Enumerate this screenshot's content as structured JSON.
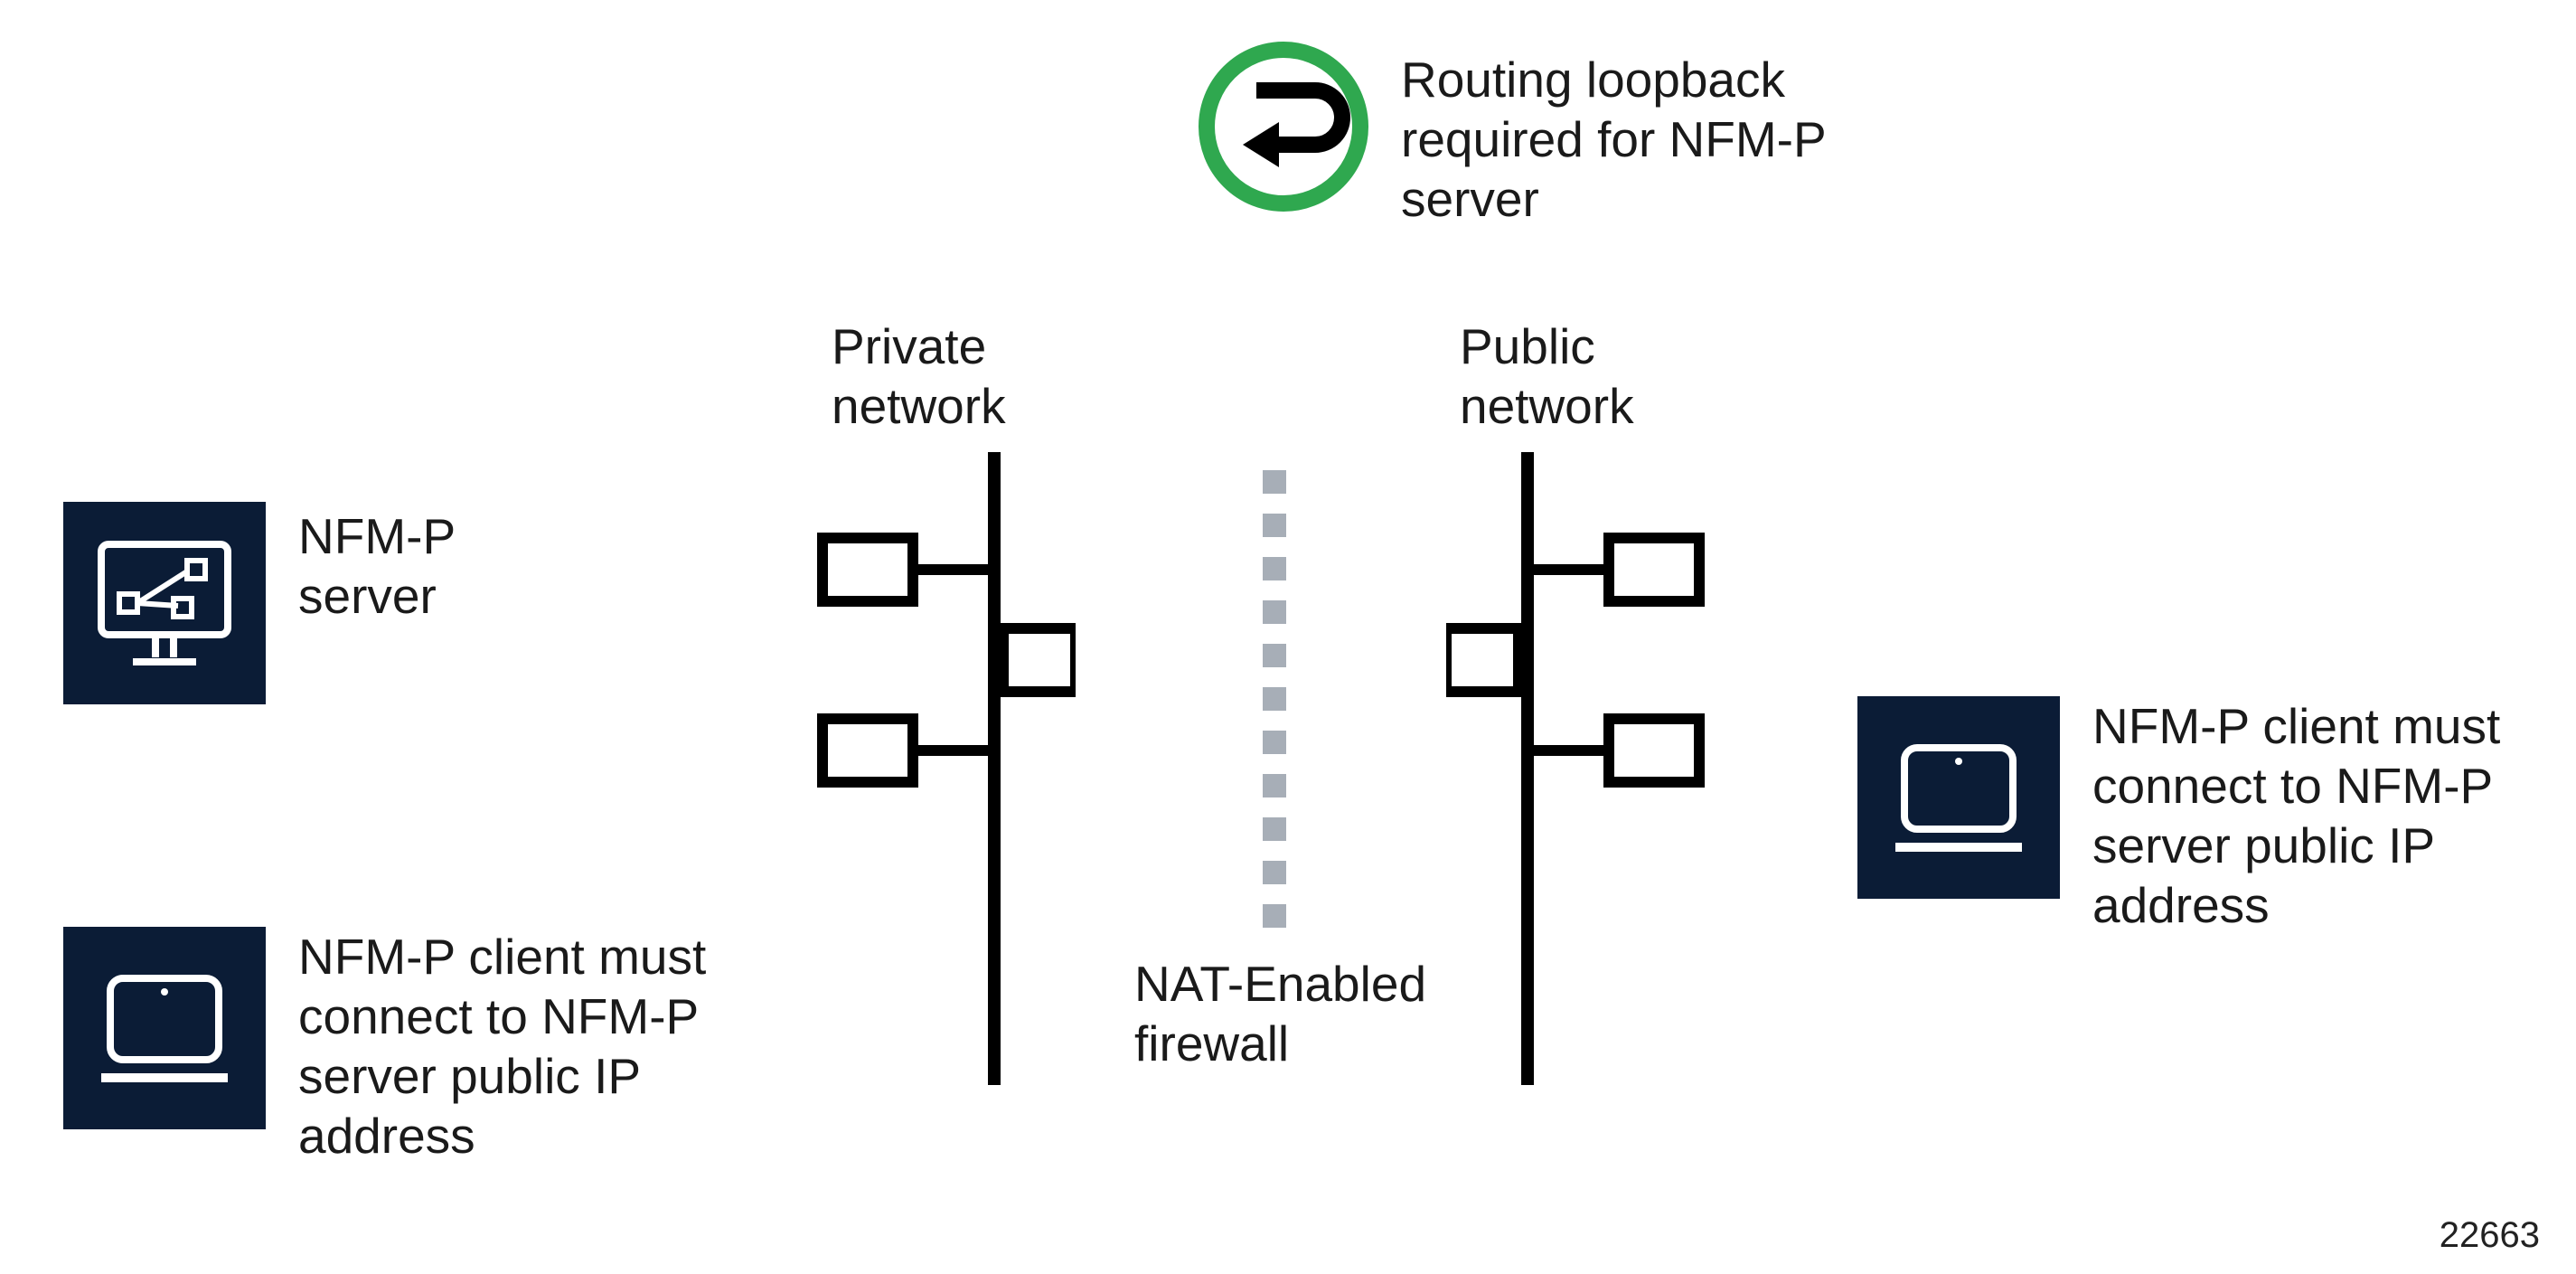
{
  "loopback_label": "Routing loopback required for NFM-P server",
  "private_network_label": "Private network",
  "public_network_label": "Public network",
  "firewall_label": "NAT-Enabled firewall",
  "server_label": "NFM-P server",
  "client_private_label": "NFM-P client must connect to NFM-P server public IP address",
  "client_public_label": "NFM-P client must connect to NFM-P server public IP address",
  "figure_id": "22663",
  "icons": {
    "loopback": "loopback-icon",
    "server": "server-monitor-icon",
    "client": "laptop-icon",
    "network_bus": "network-bus-icon",
    "firewall": "firewall-dashed-icon"
  },
  "colors": {
    "tile_bg": "#0b1c36",
    "loopback_ring": "#2fa84f",
    "firewall_dash": "#a7aeb7"
  }
}
